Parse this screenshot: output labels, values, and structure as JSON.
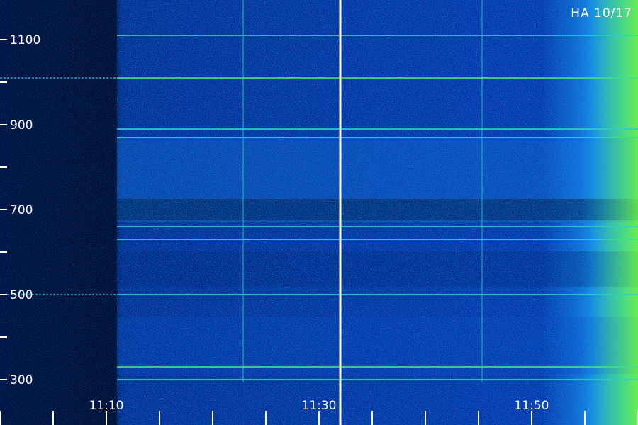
{
  "chart_data": {
    "type": "heatmap",
    "title": "HA 10/17",
    "xlabel": "",
    "ylabel": "",
    "x_ticks": [
      "11:10",
      "11:30",
      "11:50"
    ],
    "y_ticks": [
      300,
      500,
      700,
      900,
      1100
    ],
    "ylim": [
      240,
      1150
    ],
    "xlim_minutes": [
      0,
      60
    ],
    "colorscale": [
      "#000022",
      "#0a2a9a",
      "#1460e8",
      "#19c8e6",
      "#4ce070",
      "#7cf23a"
    ],
    "marker_time": "11:30",
    "band_peak_rows": [
      300,
      330,
      500,
      630,
      660,
      870,
      890,
      1010,
      1110
    ],
    "grid": false
  }
}
